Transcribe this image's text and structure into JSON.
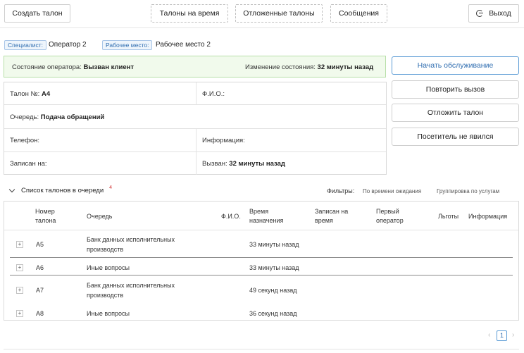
{
  "topbar": {
    "create_ticket": "Создать талон",
    "timed_tickets": "Талоны на время",
    "postponed_tickets": "Отложенные талоны",
    "messages": "Сообщения",
    "exit": "Выход"
  },
  "operator": {
    "specialist_label": "Специалист:",
    "specialist_value": "Оператор 2",
    "workplace_label": "Рабочее место:",
    "workplace_value": "Рабочее место 2"
  },
  "status": {
    "state_label": "Состояние оператора:",
    "state_value": "Вызван клиент",
    "change_label": "Изменение состояния:",
    "change_value": "32 минуты назад"
  },
  "ticket_card": {
    "ticket_label": "Талон №:",
    "ticket_value": "А4",
    "fio_label": "Ф.И.О.:",
    "queue_label": "Очередь:",
    "queue_value": "Подача обращений",
    "phone_label": "Телефон:",
    "info_label": "Информация:",
    "booked_label": "Записан на:",
    "called_label": "Вызван:",
    "called_value": "32 минуты назад"
  },
  "actions": {
    "start_service": "Начать обслуживание",
    "repeat_call": "Повторить вызов",
    "postpone": "Отложить талон",
    "no_show": "Посетитель не явился"
  },
  "queue": {
    "title": "Список талонов в очереди",
    "count": "4",
    "filters_label": "Фильтры:",
    "filter_wait": "По времени ожидания",
    "filter_group": "Группировка по услугам",
    "columns": {
      "number_l1": "Номер",
      "number_l2": "талона",
      "queue": "Очередь",
      "fio": "Ф.И.О.",
      "assigned_l1": "Время",
      "assigned_l2": "назначения",
      "booked_l1": "Записан на",
      "booked_l2": "время",
      "first_l1": "Первый",
      "first_l2": "оператор",
      "benefits": "Льготы",
      "info": "Информация"
    },
    "rows": [
      {
        "number": "А5",
        "queue_l1": "Банк данных исполнительных",
        "queue_l2": "производств",
        "time": "33 минуты назад"
      },
      {
        "number": "А6",
        "queue_l1": "Иные вопросы",
        "queue_l2": "",
        "time": "33 минуты назад"
      },
      {
        "number": "А7",
        "queue_l1": "Банк данных исполнительных",
        "queue_l2": "производств",
        "time": "49 секунд назад"
      },
      {
        "number": "А8",
        "queue_l1": "Иные вопросы",
        "queue_l2": "",
        "time": "36 секунд назад"
      }
    ],
    "expand_symbol": "+"
  },
  "pagination": {
    "prev": "‹",
    "current": "1",
    "next": "›"
  }
}
